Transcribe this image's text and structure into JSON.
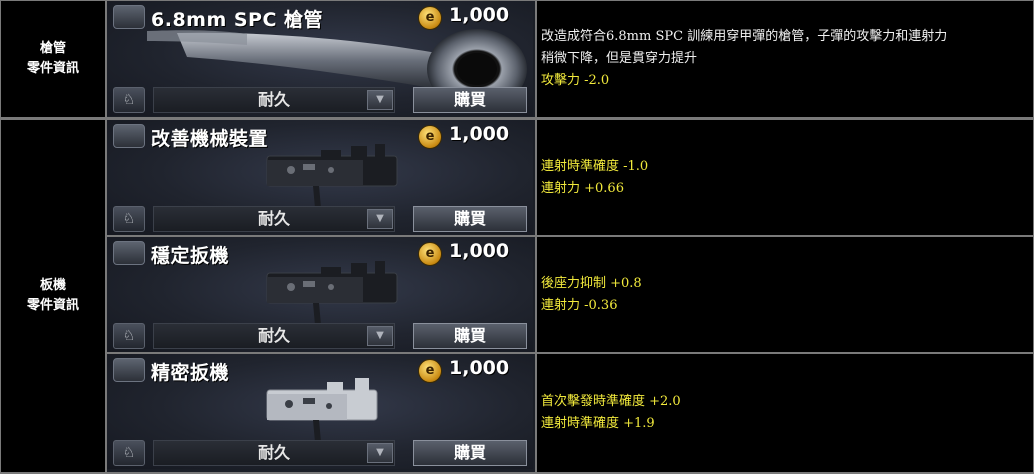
{
  "rows": [
    {
      "label_line1": "槍管",
      "label_line2": "零件資訊",
      "items": [
        {
          "name": "6.8mm SPC 槍管",
          "price": "1,000",
          "durability": "耐久",
          "buy": "購買",
          "desc_lines": [
            "改造成符合6.8mm SPC 訓練用穿甲彈的槍管，子彈的攻擊力和連射力",
            "稍微下降，但是貫穿力提升"
          ],
          "stat_lines": [
            "攻擊力 -2.0"
          ]
        }
      ]
    },
    {
      "label_line1": "板機",
      "label_line2": "零件資訊",
      "items": [
        {
          "name": "改善機械裝置",
          "price": "1,000",
          "durability": "耐久",
          "buy": "購買",
          "desc_lines": [],
          "stat_lines": [
            "連射時準確度 -1.0",
            "連射力 +0.66"
          ]
        },
        {
          "name": "穩定扳機",
          "price": "1,000",
          "durability": "耐久",
          "buy": "購買",
          "desc_lines": [],
          "stat_lines": [
            "後座力抑制 +0.8",
            "連射力 -0.36"
          ]
        },
        {
          "name": "精密扳機",
          "price": "1,000",
          "durability": "耐久",
          "buy": "購買",
          "desc_lines": [],
          "stat_lines": [
            "首次擊發時準確度 +2.0",
            "連射時準確度 +1.9"
          ]
        }
      ]
    }
  ],
  "icons": {
    "coin": "coin-icon",
    "duck": "duck-icon",
    "dropdown": "chevron-down-icon",
    "barrel_type": "barrel-icon",
    "trigger_type": "trigger-icon"
  },
  "colors": {
    "stat_text": "#f2ea3c",
    "desc_text": "#f0f0f0",
    "cell_bg": "#000000",
    "border": "#7a7a7a"
  }
}
